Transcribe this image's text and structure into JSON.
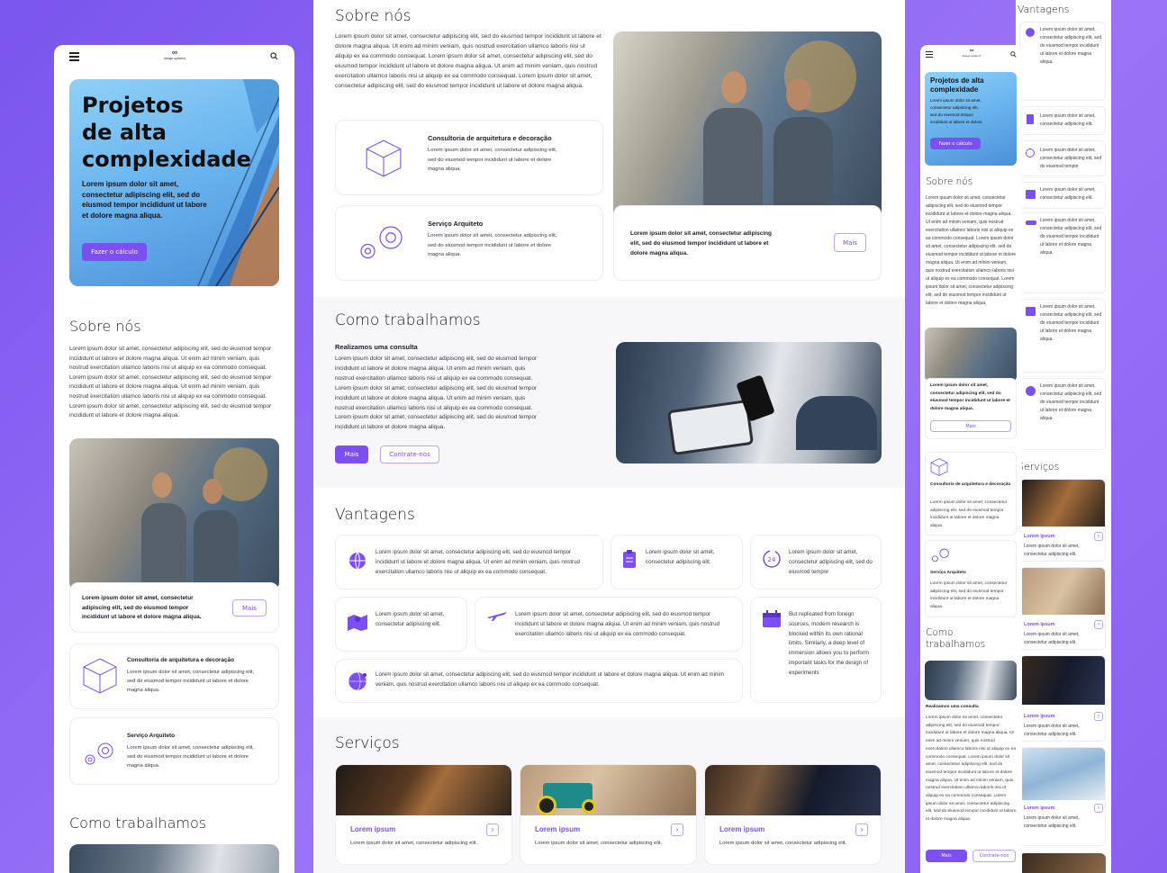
{
  "brand": {
    "name": "design systems",
    "accent": "#7b4ff0",
    "background": "#8e67f3"
  },
  "icons": [
    "hamburger-icon",
    "search-icon",
    "box-icon",
    "gears-icon",
    "globe-icon",
    "clipboard-icon",
    "clock-24-icon",
    "map-icon",
    "airplane-icon",
    "calendar-icon",
    "world-network-icon",
    "arrow-right-icon"
  ],
  "hero": {
    "title_line1": "Projetos",
    "title_line2": "de alta",
    "title_line3": "complexidade",
    "title_compact": "Projetos de alta complexidade",
    "subtitle": "Lorem ipsum dolor sit amet, consectetur adipiscing elit, sed do eiusmod tempor incididunt ut labore et dolore magna aliqua.",
    "cta": "Fazer o cálculo"
  },
  "sobre": {
    "title": "Sobre nós",
    "text": "Lorem ipsum dolor sit amet, consectetur adipiscing elit, sed do eiusmod tempor incididunt ut labore et dolore magna aliqua. Ut enim ad minim veniam, quis nostrud exercitation ullamco laboris nisi ut aliquip ex ea commodo consequat. Lorem ipsum dolor sit amet, consectetur adipiscing elit, sed do eiusmod tempor incididunt ut labore et dolore magna aliqua. Ut enim ad minim veniam, quis nostrud exercitation ullamco laboris nisi ut aliquip ex ea commodo consequat. Lorem ipsum dolor sit amet, consectetur adipiscing elit, sed do eiusmod tempor incididunt ut labore et dolore magna aliqua.",
    "photo_caption": "Lorem ipsum dolor sit amet, consectetur adipiscing elit, sed do eiusmod tempor incididunt ut labore et dolore magna aliqua.",
    "more": "Mais",
    "services": [
      {
        "title": "Consultoria de arquitetura e decoração",
        "text": "Lorem ipsum dolor sit amet, consectetur adipiscing elit, sed do eiusmod tempor incididunt ut labore et dolore magna aliqua."
      },
      {
        "title": "Serviço Arquiteto",
        "text": "Lorem ipsum dolor sit amet, consectetur adipiscing elit, sed do eiusmod tempor incididunt ut labore et dolore magna aliqua."
      }
    ]
  },
  "como": {
    "title": "Como trabalhamos",
    "subtitle": "Realizamos uma consulta",
    "text": "Lorem ipsum dolor sit amet, consectetur adipiscing elit, sed do eiusmod tempor incididunt ut labore et dolore magna aliqua. Ut enim ad minim veniam, quis nostrud exercitation ullamco laboris nisi ut aliquip ex ea commodo consequat. Lorem ipsum dolor sit amet, consectetur adipiscing elit, sed do eiusmod tempor incididunt ut labore et dolore magna aliqua. Ut enim ad minim veniam, quis nostrud exercitation ullamco laboris nisi ut aliquip ex ea commodo consequat. Lorem ipsum dolor sit amet, consectetur adipiscing elit, sed do eiusmod tempor incididunt ut labore et dolore magna aliqua.",
    "btn_more": "Mais",
    "btn_hire": "Contrate-nos"
  },
  "vantagens": {
    "title": "Vantagens",
    "items": [
      "Lorem ipsum dolor sit amet, consectetur adipiscing elit, sed do eiusmod tempor incididunt ut labore et dolore magna aliqua. Ut enim ad minim veniam, quis nostrud exercitation ullamco laboris nisi ut aliquip ex ea commodo consequat.",
      "Lorem ipsum dolor sit amet, consectetur adipiscing elit.",
      "Lorem ipsum dolor sit amet, consectetur adipiscing elit, sed do eiusmod tempor",
      "Lorem ipsum dolor sit amet, consectetur adipiscing elit.",
      "Lorem ipsum dolor sit amet, consectetur adipiscing elit, sed do eiusmod tempor incididunt ut labore et dolore magna aliqua. Ut enim ad minim veniam, quis nostrud exercitation ullamco laboris nisi ut aliquip ex ea commodo consequat.",
      "But replicated from foreign sources, modern research is blocked within its own rational limits. Similarly, a deep level of immersion allows you to perform important tasks for the design of experiments",
      "Lorem ipsum dolor sit amet, consectetur adipiscing elit, sed do eiusmod tempor incididunt ut labore et dolore magna aliqua. Ut enim ad minim veniam, quis nostrud exercitation ullamco laboris nisi ut aliquip ex ea commodo consequat."
    ],
    "narrow_a": "Lorem ipsum dolor sit amet, consectetur adipiscing elit, sed do eiusmod tempor incididunt ut labore et dolore magna aliqua.",
    "narrow_b": "Lorem ipsum dolor sit amet, consectetur adipiscing elit."
  },
  "servicos": {
    "title": "Serviços",
    "card_title": "Lorem ipsum",
    "card_text": "Lorem ipsum dolor sit amet, consectetur adipiscing elit."
  }
}
